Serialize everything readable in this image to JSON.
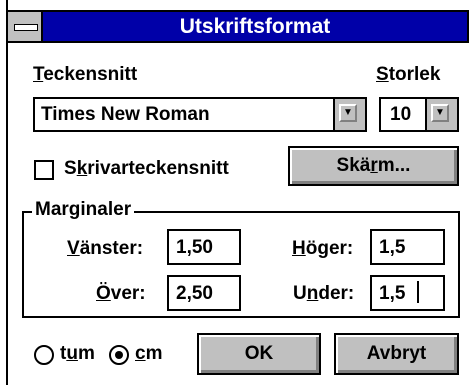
{
  "window": {
    "title": "Utskriftsformat"
  },
  "font": {
    "label": "Teckensnitt",
    "value": "Times New Roman",
    "size_label": "Storlek",
    "size_value": "10"
  },
  "printer_fonts": {
    "label": "Skrivarteckensnitt",
    "checked": false
  },
  "screen_button": {
    "label": "Skärm..."
  },
  "margins": {
    "label": "Marginaler",
    "left_label": "Vänster:",
    "left_value": "1,50",
    "right_label": "Höger:",
    "right_value": "1,5",
    "top_label": "Över:",
    "top_value": "2,50",
    "bottom_label": "Under:",
    "bottom_value": "1,5"
  },
  "units": {
    "inch_label": "tum",
    "cm_label": "cm",
    "selected": "cm"
  },
  "buttons": {
    "ok": "OK",
    "cancel": "Avbryt"
  },
  "icons": {
    "dropdown": "down-arrow-icon",
    "system_menu": "system-menu-icon"
  },
  "colors": {
    "titlebar": "#0000a8",
    "button_face": "#c0c0c0"
  }
}
